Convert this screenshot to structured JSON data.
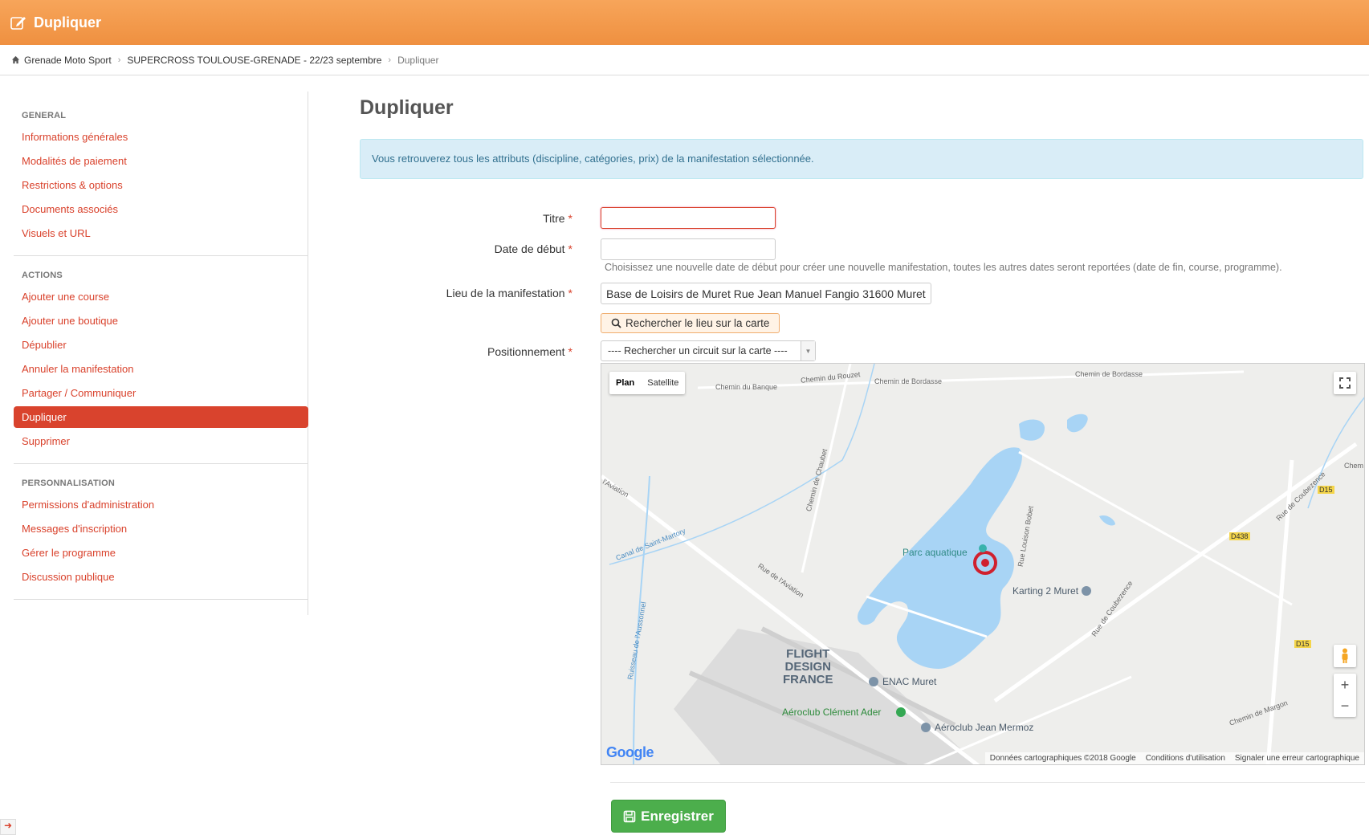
{
  "header": {
    "title": "Dupliquer",
    "icon": "edit-icon"
  },
  "breadcrumb": {
    "home": "Grenade Moto Sport",
    "event": "SUPERCROSS TOULOUSE-GRENADE - 22/23 septembre",
    "current": "Dupliquer"
  },
  "sidebar": {
    "general_title": "GENERAL",
    "general": [
      "Informations générales",
      "Modalités de paiement",
      "Restrictions & options",
      "Documents associés",
      "Visuels et URL"
    ],
    "actions_title": "ACTIONS",
    "actions": [
      "Ajouter une course",
      "Ajouter une boutique",
      "Dépublier",
      "Annuler la manifestation",
      "Partager / Communiquer",
      "Dupliquer",
      "Supprimer"
    ],
    "perso_title": "PERSONNALISATION",
    "perso": [
      "Permissions d'administration",
      "Messages d'inscription",
      "Gérer le programme",
      "Discussion publique"
    ]
  },
  "main": {
    "title": "Dupliquer",
    "alert": "Vous retrouverez tous les attributs (discipline, catégories, prix) de la manifestation sélectionnée.",
    "titre_label": "Titre",
    "titre_value": "",
    "date_label": "Date de début",
    "date_value": "",
    "date_help": "Choisissez une nouvelle date de début pour créer une nouvelle manifestation, toutes les autres dates seront reportées (date de fin, course, programme).",
    "lieu_label": "Lieu de la manifestation",
    "lieu_value": "Base de Loisirs de Muret Rue Jean Manuel Fangio 31600 Muret",
    "search_button": "Rechercher le lieu sur la carte",
    "position_label": "Positionnement",
    "position_select": "---- Rechercher un circuit sur la carte ----",
    "required_mark": "*",
    "save_button": "Enregistrer"
  },
  "map": {
    "plan": "Plan",
    "satellite": "Satellite",
    "footer_data": "Données cartographiques ©2018 Google",
    "footer_terms": "Conditions d'utilisation",
    "footer_report": "Signaler une erreur cartographique",
    "logo": "Google",
    "labels": {
      "parc": "Parc aquatique",
      "karting": "Karting 2 Muret",
      "enac": "ENAC Muret",
      "aeroclub_ader": "Aéroclub Clément Ader",
      "aeroclub_mermoz": "Aéroclub Jean Mermoz",
      "flight": "FLIGHT",
      "design": "DESIGN",
      "france": "FRANCE",
      "aviation1": "Rue de l'Aviation",
      "aviation2": "l'Aviation",
      "canal": "Canal de Saint-Martory",
      "ruisseau": "Ruisseau de l'Aussonnel",
      "coubezence1": "Rue de Coubezence",
      "coubezence2": "Rue de Coubezence",
      "banque": "Chemin du Banque",
      "rouzet": "Chemin du Rouzet",
      "bordasse1": "Chemin de Bordasse",
      "bordasse2": "Chemin de Bordasse",
      "chaubet": "Chemin de Chaubet",
      "bobet": "Rue Louison Bobet",
      "margon": "Chemin de Margon",
      "chem": "Chem",
      "d15a": "D15",
      "d15b": "D15",
      "d438": "D438"
    }
  },
  "colors": {
    "accent": "#ef9040",
    "link": "#d9412b",
    "success": "#4cae4c",
    "water": "#a8d4f5"
  }
}
